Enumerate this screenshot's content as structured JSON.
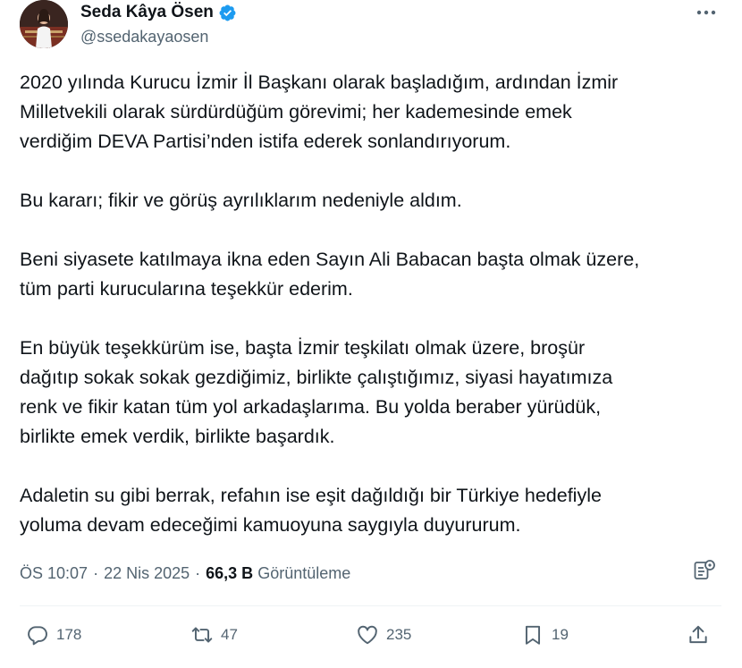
{
  "author": {
    "name": "Seda Kâya Ösen",
    "handle": "@ssedakayaosen",
    "verified": true,
    "verified_color": "#1d9bf0"
  },
  "tweet": {
    "paragraphs": [
      "2020 yılında Kurucu İzmir İl Başkanı olarak başladığım, ardından İzmir\nMilletvekili olarak sürdürdüğüm görevimi; her kademesinde emek\nverdiğim DEVA Partisi’nden istifa ederek sonlandırıyorum.",
      "Bu kararı; fikir ve görüş ayrılıklarım nedeniyle aldım.",
      "Beni siyasete katılmaya ikna eden Sayın Ali Babacan başta olmak üzere,\ntüm parti kurucularına teşekkür ederim.",
      "En büyük teşekkürüm ise, başta İzmir teşkilatı olmak üzere, broşür\ndağıtıp sokak sokak gezdiğimiz, birlikte çalıştığımız, siyasi hayatımıza\nrenk ve fikir katan tüm yol arkadaşlarıma. Bu yolda beraber yürüdük,\nbirlikte emek verdik, birlikte başardık.",
      "Adaletin su gibi berrak, refahın ise eşit dağıldığı bir Türkiye hedefiyle\nyoluma devam edeceğimi kamuoyuna saygıyla duyururum."
    ],
    "time": "ÖS 10:07",
    "date": "22 Nis 2025",
    "views_count": "66,3 B",
    "views_label": "Görüntüleme"
  },
  "actions": {
    "replies": "178",
    "reposts": "47",
    "likes": "235",
    "bookmarks": "19"
  },
  "icons": {
    "more": "more-horizontal-icon",
    "analytics": "analytics-icon",
    "reply": "reply-icon",
    "repost": "repost-icon",
    "like": "heart-icon",
    "bookmark": "bookmark-icon",
    "share": "share-icon"
  },
  "colors": {
    "text": "#0f1419",
    "secondary": "#536471",
    "divider": "#eff3f4",
    "accent": "#1d9bf0"
  }
}
